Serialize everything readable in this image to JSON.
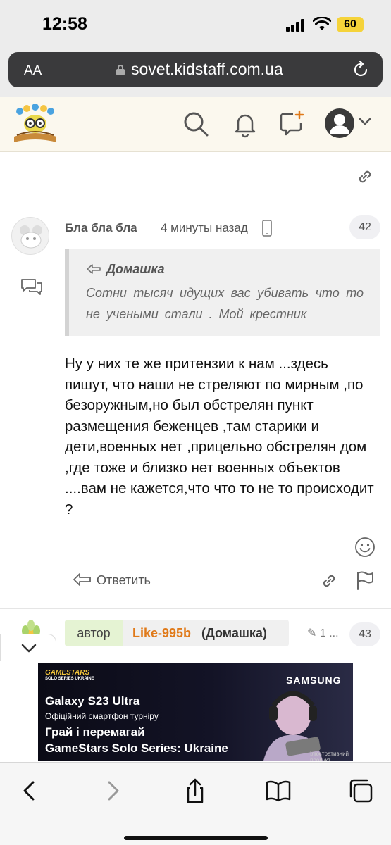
{
  "status_bar": {
    "time": "12:58",
    "battery": "60"
  },
  "browser": {
    "text_size_button": "AA",
    "url": "sovet.kidstaff.com.ua"
  },
  "post": {
    "author": "Бла бла бла",
    "time": "4 минуты назад",
    "number": "42",
    "quote": {
      "author": "Домашка",
      "text": "Сотни тысяч идущих вас убивать что то не учеными стали . Мой крестник"
    },
    "body": "Ну у них те же притензии к нам ...здесь пишут, что наши не стреляют по мирным ,по безоружным,но был обстрелян пункт размещения беженцев ,там старики и дети,военных нет ,прицельно обстрелян дом ,где тоже и близко нет военных объектов ....вам не кажется,что что то не то происходит ?",
    "reply_label": "Ответить"
  },
  "next_post": {
    "tag": "автор",
    "username": "Like-995b",
    "quoted_user": "(Домашка)",
    "edit_info": "1 ...",
    "number": "43"
  },
  "ad": {
    "brand": "GAMESTARS",
    "brand_sub": "SOLO SERIES UKRAINE",
    "sponsor": "SAMSUNG",
    "line1": "Galaxy S23 Ultra",
    "line2": "Офіційний смартфон турніру",
    "line3": "Грай і перемагай",
    "line4": "GameStars Solo Series: Ukraine",
    "disclaimer": "Ілюстративний продукт"
  },
  "icons": {
    "header": [
      "search-icon",
      "bell-icon",
      "new-message-icon",
      "user-avatar-icon"
    ],
    "toolbar": [
      "back-icon",
      "forward-icon",
      "share-icon",
      "bookmarks-icon",
      "tabs-icon"
    ]
  },
  "colors": {
    "header_bg": "#fbf8ee",
    "username": "#e07a1a",
    "author_tag": "#e5f3d3",
    "url_bar": "#3a3a3c",
    "battery": "#f5d33a"
  }
}
